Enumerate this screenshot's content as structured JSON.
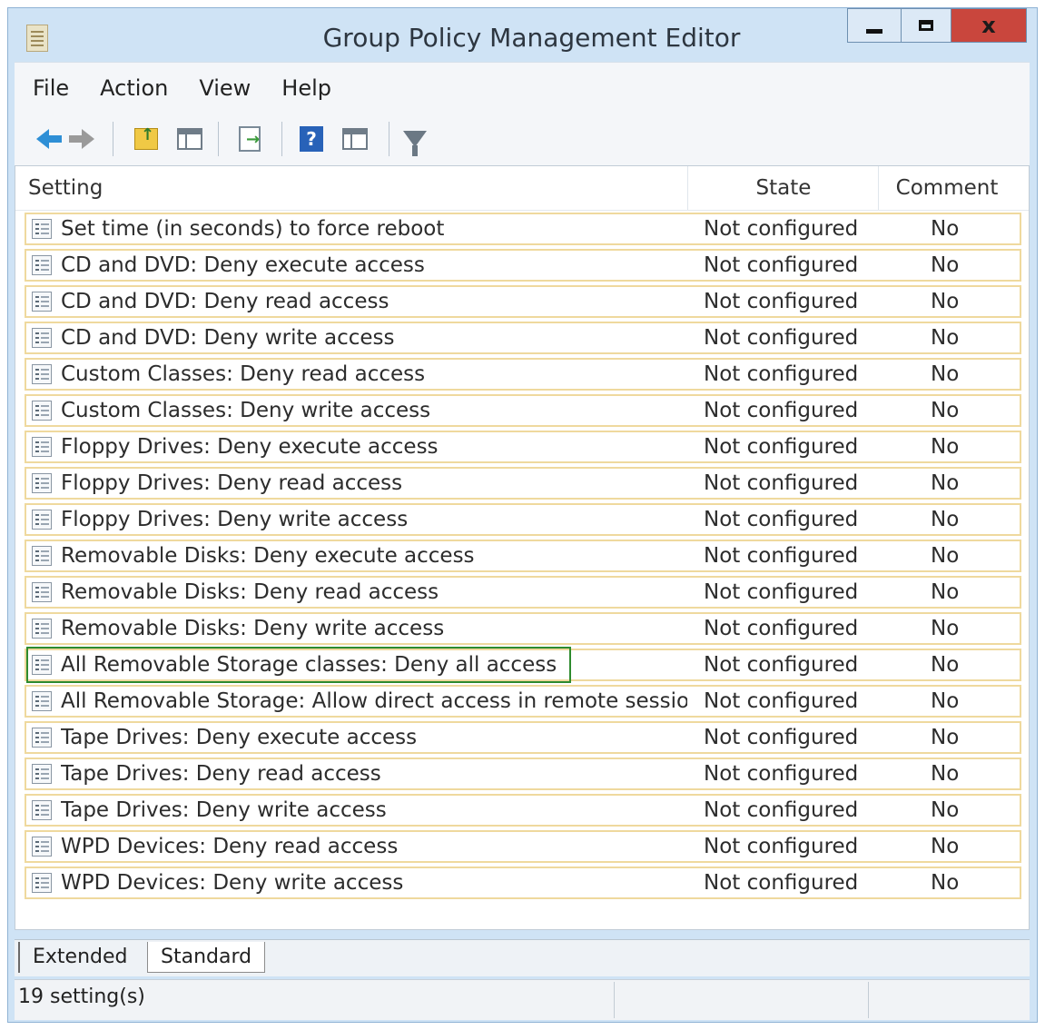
{
  "window": {
    "title": "Group Policy Management Editor",
    "minimize_icon": "minimize-icon",
    "maximize_icon": "maximize-icon",
    "close_label": "x"
  },
  "menu": [
    "File",
    "Action",
    "View",
    "Help"
  ],
  "toolbar": {
    "icons": [
      "back-arrow-icon",
      "forward-arrow-icon",
      "up-folder-icon",
      "show-hide-pane-icon",
      "export-list-icon",
      "help-icon",
      "show-hide-action-pane-icon",
      "filter-icon"
    ]
  },
  "columns": {
    "setting": "Setting",
    "state": "State",
    "comment": "Comment"
  },
  "rows": [
    {
      "setting": "Set time (in seconds) to force reboot",
      "state": "Not configured",
      "comment": "No"
    },
    {
      "setting": "CD and DVD: Deny execute access",
      "state": "Not configured",
      "comment": "No"
    },
    {
      "setting": "CD and DVD: Deny read access",
      "state": "Not configured",
      "comment": "No"
    },
    {
      "setting": "CD and DVD: Deny write access",
      "state": "Not configured",
      "comment": "No"
    },
    {
      "setting": "Custom Classes: Deny read access",
      "state": "Not configured",
      "comment": "No"
    },
    {
      "setting": "Custom Classes: Deny write access",
      "state": "Not configured",
      "comment": "No"
    },
    {
      "setting": "Floppy Drives: Deny execute access",
      "state": "Not configured",
      "comment": "No"
    },
    {
      "setting": "Floppy Drives: Deny read access",
      "state": "Not configured",
      "comment": "No"
    },
    {
      "setting": "Floppy Drives: Deny write access",
      "state": "Not configured",
      "comment": "No"
    },
    {
      "setting": "Removable Disks: Deny execute access",
      "state": "Not configured",
      "comment": "No"
    },
    {
      "setting": "Removable Disks: Deny read access",
      "state": "Not configured",
      "comment": "No"
    },
    {
      "setting": "Removable Disks: Deny write access",
      "state": "Not configured",
      "comment": "No"
    },
    {
      "setting": "All Removable Storage classes: Deny all access",
      "state": "Not configured",
      "comment": "No",
      "highlighted": true
    },
    {
      "setting": "All Removable Storage: Allow direct access in remote sessions",
      "state": "Not configured",
      "comment": "No"
    },
    {
      "setting": "Tape Drives: Deny execute access",
      "state": "Not configured",
      "comment": "No"
    },
    {
      "setting": "Tape Drives: Deny read access",
      "state": "Not configured",
      "comment": "No"
    },
    {
      "setting": "Tape Drives: Deny write access",
      "state": "Not configured",
      "comment": "No"
    },
    {
      "setting": "WPD Devices: Deny read access",
      "state": "Not configured",
      "comment": "No"
    },
    {
      "setting": "WPD Devices: Deny write access",
      "state": "Not configured",
      "comment": "No"
    }
  ],
  "tabs": [
    "Extended",
    "Standard"
  ],
  "status": {
    "text": "19 setting(s)"
  },
  "colors": {
    "row_border": "#efd99e",
    "highlight_border": "#2e8b2e",
    "close_button": "#c9463d",
    "title_bar": "#cfe3f5"
  }
}
